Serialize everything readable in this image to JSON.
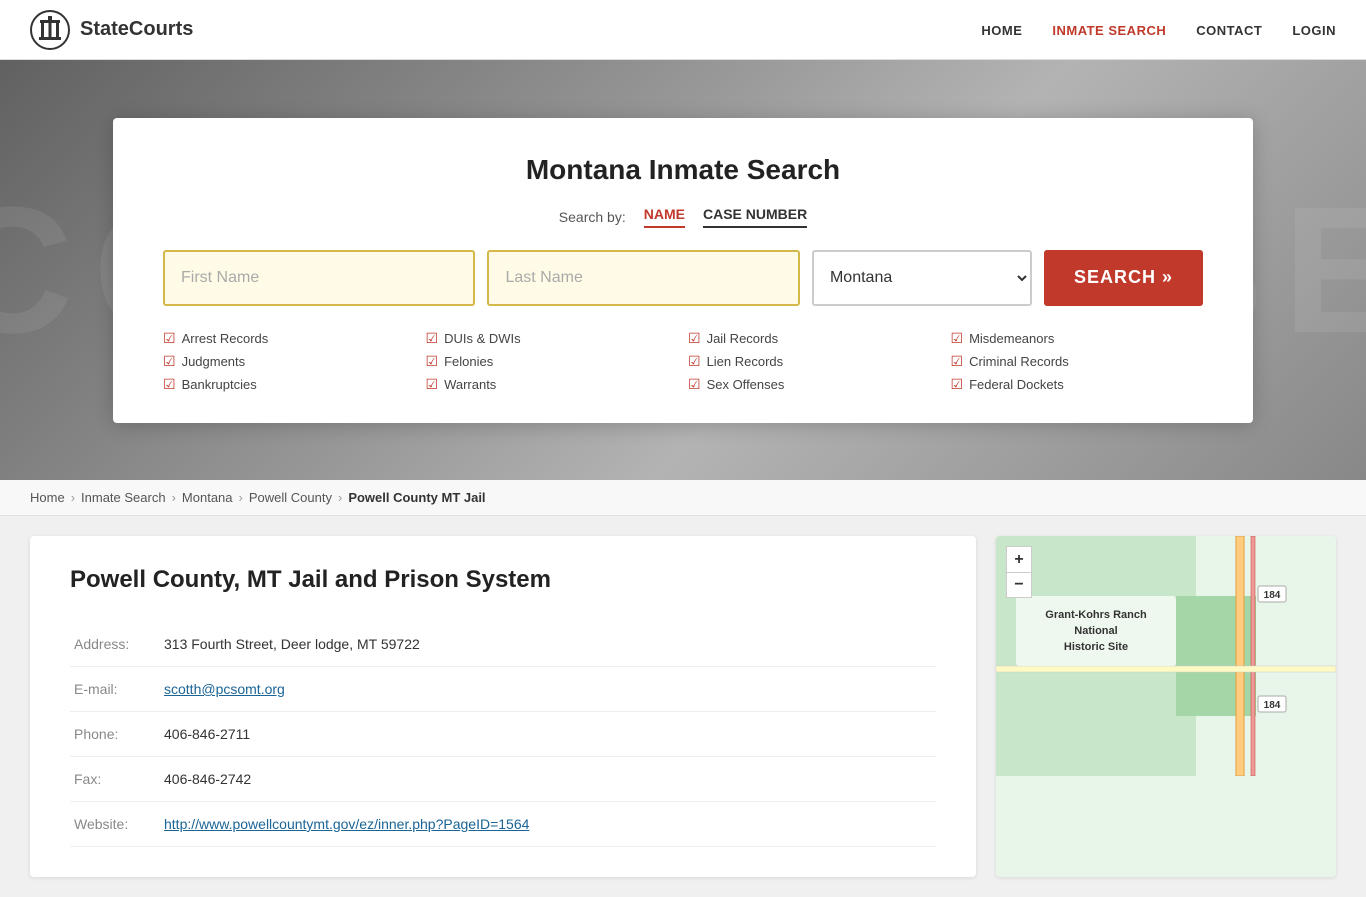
{
  "header": {
    "logo_text": "StateCourts",
    "nav": [
      {
        "label": "HOME",
        "active": false,
        "id": "home"
      },
      {
        "label": "INMATE SEARCH",
        "active": true,
        "id": "inmate-search"
      },
      {
        "label": "CONTACT",
        "active": false,
        "id": "contact"
      },
      {
        "label": "LOGIN",
        "active": false,
        "id": "login"
      }
    ]
  },
  "hero": {
    "bg_text": "COURTHOUSE"
  },
  "search_card": {
    "title": "Montana Inmate Search",
    "search_by_label": "Search by:",
    "tabs": [
      {
        "label": "NAME",
        "active": true,
        "id": "tab-name"
      },
      {
        "label": "CASE NUMBER",
        "active": false,
        "id": "tab-case"
      }
    ],
    "first_name_placeholder": "First Name",
    "last_name_placeholder": "Last Name",
    "state_value": "Montana",
    "search_button_label": "SEARCH »",
    "checkboxes": [
      "Arrest Records",
      "DUIs & DWIs",
      "Jail Records",
      "Misdemeanors",
      "Judgments",
      "Felonies",
      "Lien Records",
      "Criminal Records",
      "Bankruptcies",
      "Warrants",
      "Sex Offenses",
      "Federal Dockets"
    ]
  },
  "breadcrumb": {
    "items": [
      {
        "label": "Home",
        "id": "bc-home"
      },
      {
        "label": "Inmate Search",
        "id": "bc-inmate-search"
      },
      {
        "label": "Montana",
        "id": "bc-montana"
      },
      {
        "label": "Powell County",
        "id": "bc-powell-county"
      },
      {
        "label": "Powell County MT Jail",
        "id": "bc-current"
      }
    ]
  },
  "main": {
    "title": "Powell County, MT Jail and Prison System",
    "details": [
      {
        "label": "Address:",
        "value": "313 Fourth Street, Deer lodge, MT 59722",
        "type": "text",
        "id": "address"
      },
      {
        "label": "E-mail:",
        "value": "scotth@pcsomt.org",
        "type": "email",
        "id": "email"
      },
      {
        "label": "Phone:",
        "value": "406-846-2711",
        "type": "text",
        "id": "phone"
      },
      {
        "label": "Fax:",
        "value": "406-846-2742",
        "type": "text",
        "id": "fax"
      },
      {
        "label": "Website:",
        "value": "http://www.powellcountymt.gov/ez/inner.php?PageID=1564",
        "type": "url",
        "id": "website"
      }
    ],
    "map": {
      "zoom_in": "+",
      "zoom_out": "−",
      "label": "Grant-Kohrs Ranch National Historic Site",
      "road_label": "184"
    }
  }
}
